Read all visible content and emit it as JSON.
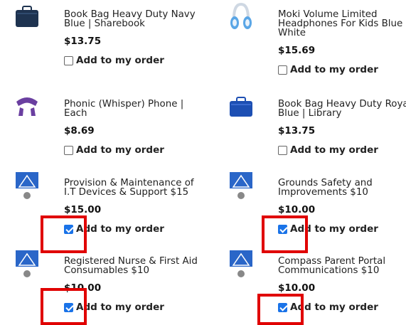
{
  "products": [
    {
      "name": "Book Bag Heavy Duty Navy Blue | Sharebook",
      "price": "$13.75",
      "checked": false,
      "icon": "navy-book-bag-icon"
    },
    {
      "name": "Moki Volume Limited Headphones For Kids Blue & White",
      "price": "$15.69",
      "checked": false,
      "icon": "headphones-icon"
    },
    {
      "name": "Phonic (Whisper) Phone | Each",
      "price": "$8.69",
      "checked": false,
      "icon": "whisper-phone-icon"
    },
    {
      "name": "Book Bag Heavy Duty Royal Blue | Library",
      "price": "$13.75",
      "checked": false,
      "icon": "royal-blue-book-bag-icon"
    },
    {
      "name": "Provision & Maintenance of I.T Devices & Support $15",
      "price": "$15.00",
      "checked": true,
      "icon": "school-logo-icon"
    },
    {
      "name": "Grounds Safety and Improvements $10",
      "price": "$10.00",
      "checked": true,
      "icon": "school-logo-icon"
    },
    {
      "name": "Registered Nurse & First Aid Consumables $10",
      "price": "$10.00",
      "checked": true,
      "icon": "school-logo-icon"
    },
    {
      "name": "Compass Parent Portal Communications $10",
      "price": "$10.00",
      "checked": true,
      "icon": "school-logo-icon"
    }
  ],
  "add_label": "Add to my order",
  "colors": {
    "highlight": "#e00000",
    "checkbox": "#1a73e8"
  }
}
